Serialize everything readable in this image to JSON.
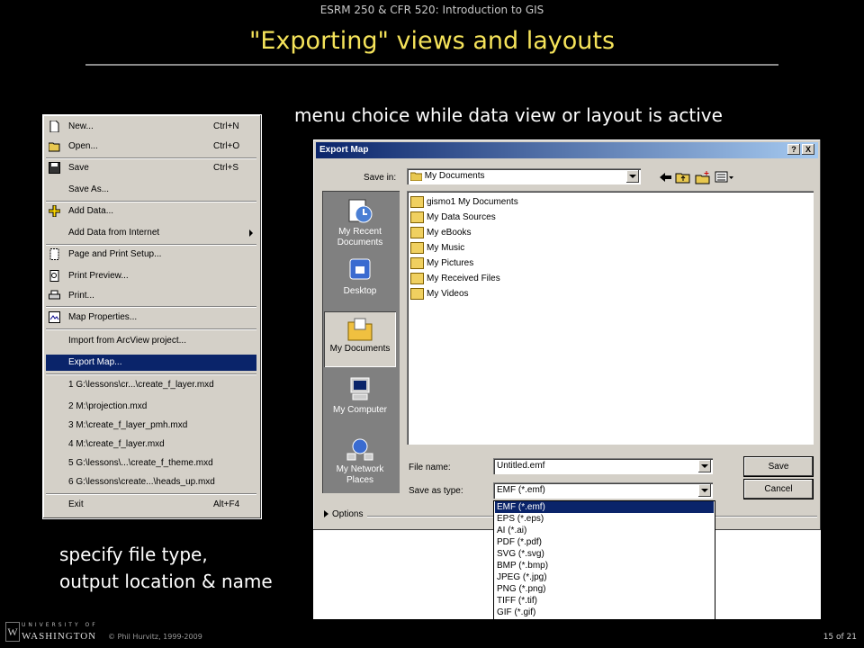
{
  "slide": {
    "course": "ESRM 250 & CFR 520: Introduction to GIS",
    "title": "\"Exporting\" views and layouts",
    "caption_top": "menu choice while data view or layout is active",
    "caption_bottom_1": "specify file type,",
    "caption_bottom_2": "output location & name",
    "copyright": "© Phil Hurvitz, 1999-2009",
    "page": "15 of 21",
    "logo_small": "UNIVERSITY OF",
    "logo_big": "WASHINGTON",
    "logo_mark": "W"
  },
  "file_menu": {
    "items": [
      {
        "label": "New...",
        "shortcut": "Ctrl+N",
        "icon": "new-document-icon"
      },
      {
        "label": "Open...",
        "shortcut": "Ctrl+O",
        "icon": "open-folder-icon"
      },
      {
        "label": "Save",
        "shortcut": "Ctrl+S",
        "icon": "save-disk-icon"
      },
      {
        "label": "Save As...",
        "shortcut": "",
        "icon": ""
      },
      {
        "label": "Add Data...",
        "shortcut": "",
        "icon": "add-data-icon"
      },
      {
        "label": "Add Data from Internet",
        "shortcut": "",
        "icon": "",
        "submenu": true
      },
      {
        "label": "Page and Print Setup...",
        "shortcut": "",
        "icon": "page-setup-icon"
      },
      {
        "label": "Print Preview...",
        "shortcut": "",
        "icon": "print-preview-icon"
      },
      {
        "label": "Print...",
        "shortcut": "",
        "icon": "printer-icon"
      },
      {
        "label": "Map Properties...",
        "shortcut": "",
        "icon": "map-properties-icon"
      },
      {
        "label": "Import from ArcView project...",
        "shortcut": "",
        "icon": ""
      },
      {
        "label": "Export Map...",
        "shortcut": "",
        "icon": "",
        "highlighted": true
      },
      {
        "label": "1 G:\\lessons\\cr...\\create_f_layer.mxd",
        "shortcut": "",
        "icon": ""
      },
      {
        "label": "2 M:\\projection.mxd",
        "shortcut": "",
        "icon": ""
      },
      {
        "label": "3 M:\\create_f_layer_pmh.mxd",
        "shortcut": "",
        "icon": ""
      },
      {
        "label": "4 M:\\create_f_layer.mxd",
        "shortcut": "",
        "icon": ""
      },
      {
        "label": "5 G:\\lessons\\...\\create_f_theme.mxd",
        "shortcut": "",
        "icon": ""
      },
      {
        "label": "6 G:\\lessons\\create...\\heads_up.mxd",
        "shortcut": "",
        "icon": ""
      },
      {
        "label": "Exit",
        "shortcut": "Alt+F4",
        "icon": ""
      }
    ]
  },
  "dialog": {
    "title": "Export Map",
    "help_btn": "?",
    "close_btn": "X",
    "save_in_label": "Save in:",
    "save_in_value": "My Documents",
    "places": [
      {
        "label": "My Recent Documents",
        "icon": "recent-documents-icon"
      },
      {
        "label": "Desktop",
        "icon": "desktop-icon"
      },
      {
        "label": "My Documents",
        "icon": "my-documents-icon",
        "selected": true
      },
      {
        "label": "My Computer",
        "icon": "my-computer-icon"
      },
      {
        "label": "My Network Places",
        "icon": "network-places-icon"
      }
    ],
    "files": [
      "gismo1 My Documents",
      "My Data Sources",
      "My eBooks",
      "My Music",
      "My Pictures",
      "My Received Files",
      "My Videos"
    ],
    "file_name_label": "File name:",
    "file_name_value": "Untitled.emf",
    "save_type_label": "Save as type:",
    "save_type_value": "EMF (*.emf)",
    "save_button": "Save",
    "cancel_button": "Cancel",
    "options_label": "Options",
    "type_options": [
      "EMF (*.emf)",
      "EPS (*.eps)",
      "AI (*.ai)",
      "PDF (*.pdf)",
      "SVG (*.svg)",
      "BMP (*.bmp)",
      "JPEG (*.jpg)",
      "PNG (*.png)",
      "TIFF (*.tif)",
      "GIF (*.gif)"
    ]
  }
}
